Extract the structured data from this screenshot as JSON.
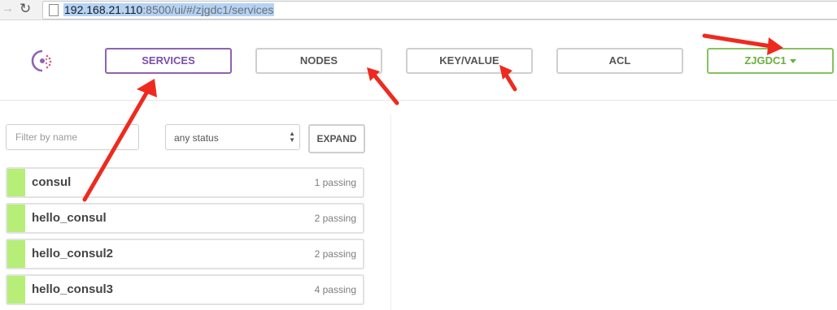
{
  "browser": {
    "url_host": "192.168.21.110",
    "url_path": ":8500/ui/#/zjgdc1/services"
  },
  "nav": {
    "items": [
      {
        "label": "SERVICES"
      },
      {
        "label": "NODES"
      },
      {
        "label": "KEY/VALUE"
      },
      {
        "label": "ACL"
      }
    ],
    "datacenter": "ZJGDC1"
  },
  "filters": {
    "name_placeholder": "Filter by name",
    "status_value": "any status",
    "expand_label": "EXPAND"
  },
  "services": [
    {
      "name": "consul",
      "status": "1 passing"
    },
    {
      "name": "hello_consul",
      "status": "2 passing"
    },
    {
      "name": "hello_consul2",
      "status": "2 passing"
    },
    {
      "name": "hello_consul3",
      "status": "4 passing"
    }
  ],
  "colors": {
    "active_nav": "#8e63b3",
    "datacenter": "#86c25e",
    "passing": "#b6ee78",
    "annotation_arrow": "#ee2a1f"
  }
}
